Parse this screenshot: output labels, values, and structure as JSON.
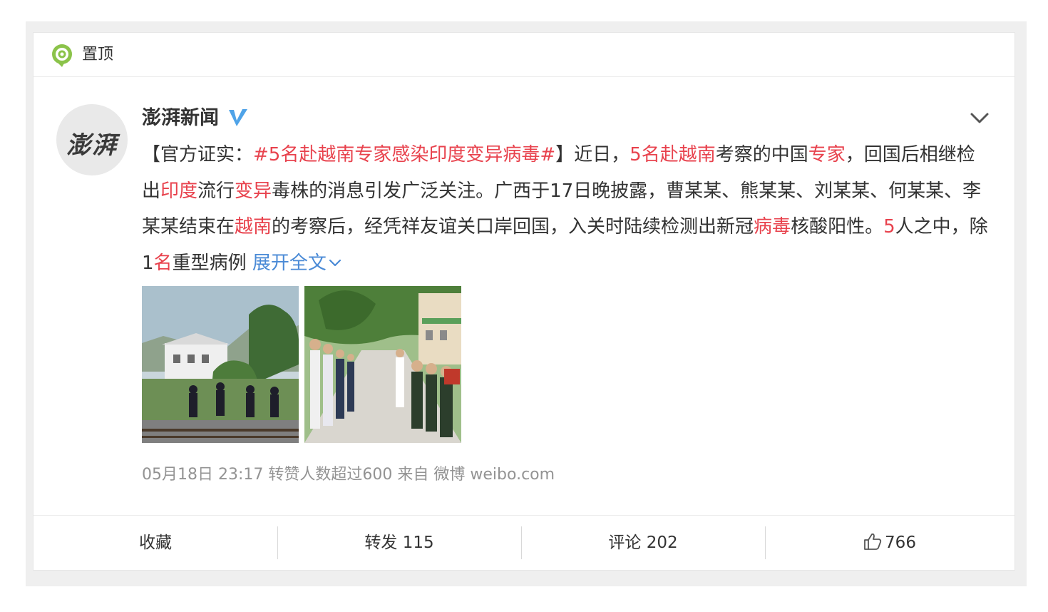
{
  "pinned": {
    "label": "置顶"
  },
  "author": {
    "name": "澎湃新闻",
    "avatar_text": "澎湃",
    "verified_color": "#4fa3e8"
  },
  "post": {
    "segments": [
      {
        "text": "【官方证实：",
        "type": "plain"
      },
      {
        "text": "#5名赴越南专家感染印度变异病毒#",
        "type": "topic"
      },
      {
        "text": "】近日，",
        "type": "plain"
      },
      {
        "text": "5名赴越南",
        "type": "hl"
      },
      {
        "text": "考察的中国",
        "type": "plain"
      },
      {
        "text": "专家",
        "type": "hl"
      },
      {
        "text": "，回国后相继检出",
        "type": "plain"
      },
      {
        "text": "印度",
        "type": "hl"
      },
      {
        "text": "流行",
        "type": "plain"
      },
      {
        "text": "变异",
        "type": "hl"
      },
      {
        "text": "毒株的消息引发广泛关注。广西于17日晚披露，曹某某、熊某某、刘某某、何某某、李某某结束在",
        "type": "plain"
      },
      {
        "text": "越南",
        "type": "hl"
      },
      {
        "text": "的考察后，经凭祥友谊关口岸回国，入关时陆续检测出新冠",
        "type": "plain"
      },
      {
        "text": "病毒",
        "type": "hl"
      },
      {
        "text": "核酸阳性。",
        "type": "plain"
      },
      {
        "text": "5",
        "type": "hl"
      },
      {
        "text": "人之中，除1",
        "type": "plain"
      },
      {
        "text": "名",
        "type": "hl"
      },
      {
        "text": "重型病例 ",
        "type": "plain"
      }
    ],
    "expand_label": "展开全文"
  },
  "meta": {
    "time": "05月18日 23:17",
    "reposters": "转赞人数超过600",
    "from_label": "来自",
    "source": "微博 weibo.com"
  },
  "actions": {
    "favorite": "收藏",
    "repost": "转发 115",
    "comment": "评论 202",
    "like_count": "766"
  },
  "colors": {
    "highlight": "#e8424d",
    "link": "#4a8ad6",
    "meta": "#939393",
    "pin_green": "#7fc244"
  }
}
